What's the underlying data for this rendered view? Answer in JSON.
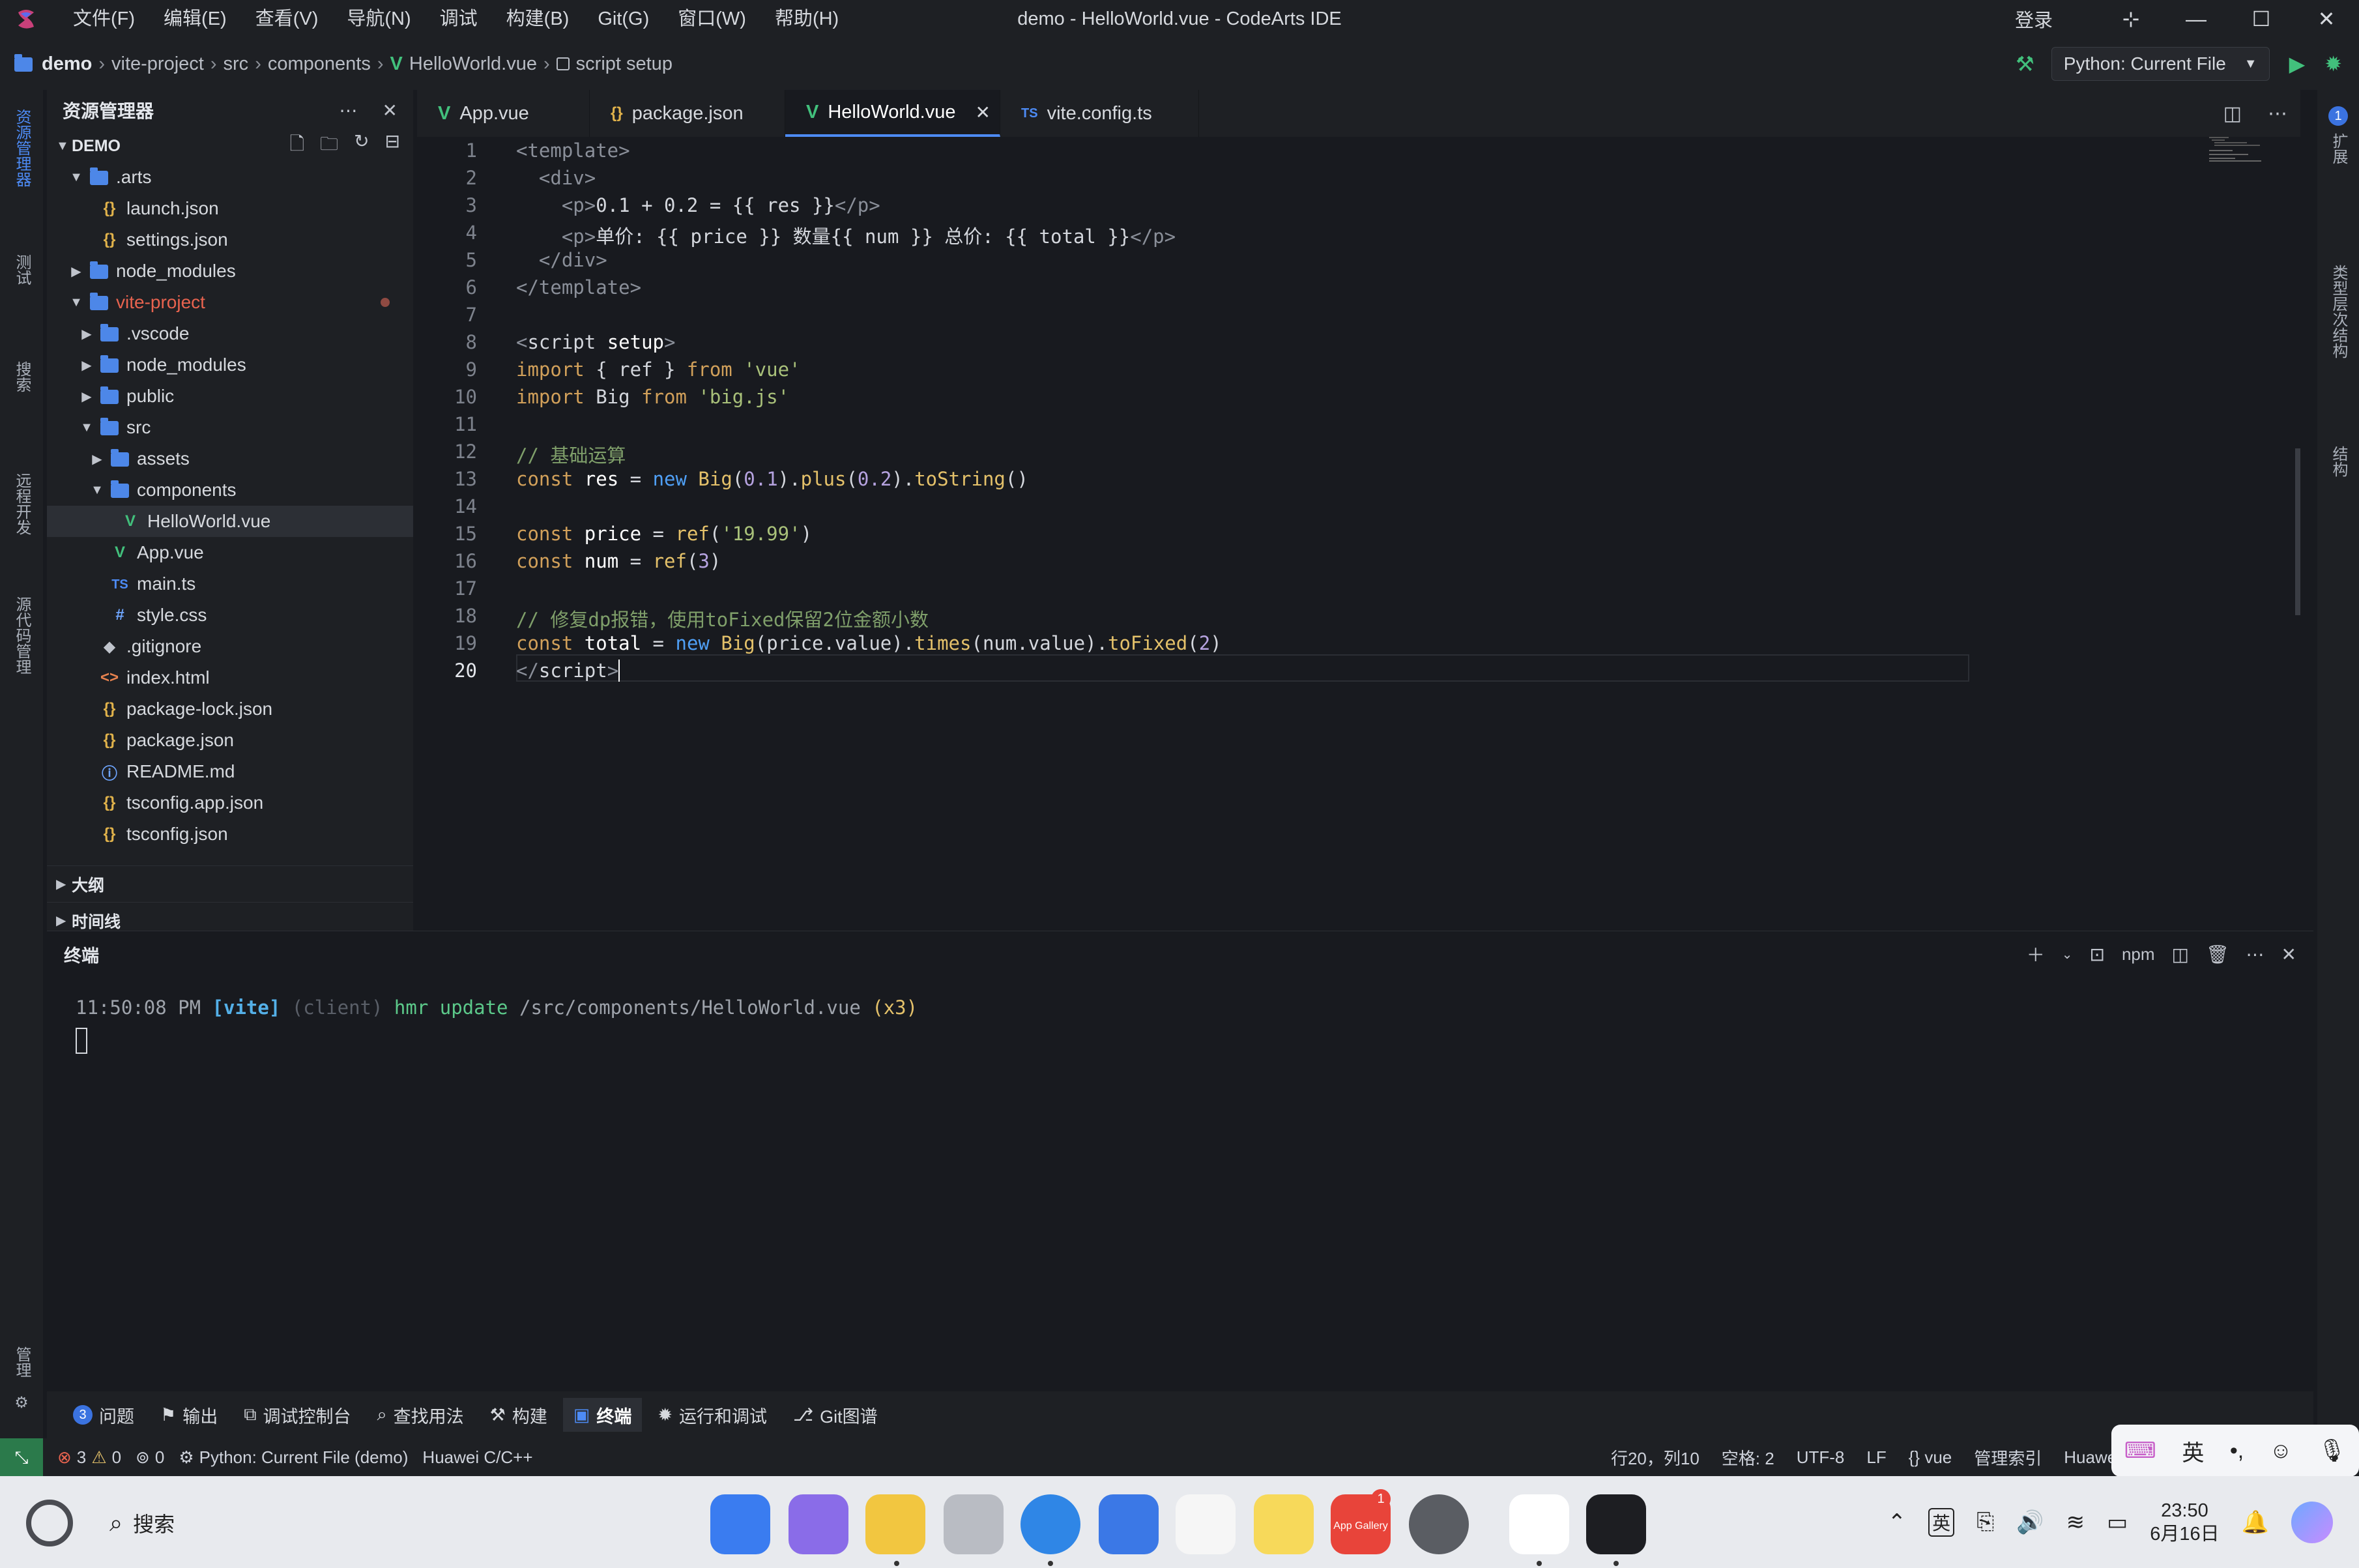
{
  "window": {
    "title": "demo - HelloWorld.vue - CodeArts IDE",
    "menu": [
      "文件(F)",
      "编辑(E)",
      "查看(V)",
      "导航(N)",
      "调试",
      "构建(B)",
      "Git(G)",
      "窗口(W)",
      "帮助(H)"
    ],
    "login": "登录"
  },
  "breadcrumb": [
    "demo",
    "vite-project",
    "src",
    "components",
    "HelloWorld.vue",
    "script setup"
  ],
  "run_config": "Python: Current File",
  "activity": [
    "资源管理器",
    "测试",
    "搜索",
    "远程开发",
    "源代码管理",
    "管理"
  ],
  "right_activity": [
    "扩展",
    "类型层次结构",
    "结构"
  ],
  "explorer": {
    "title": "资源管理器",
    "root": "DEMO",
    "items": [
      {
        "label": ".arts",
        "depth": 1,
        "kind": "folder-open"
      },
      {
        "label": "launch.json",
        "depth": 2,
        "kind": "json"
      },
      {
        "label": "settings.json",
        "depth": 2,
        "kind": "json"
      },
      {
        "label": "node_modules",
        "depth": 1,
        "kind": "folder"
      },
      {
        "label": "vite-project",
        "depth": 1,
        "kind": "folder-open"
      },
      {
        "label": ".vscode",
        "depth": 2,
        "kind": "folder"
      },
      {
        "label": "node_modules",
        "depth": 2,
        "kind": "folder"
      },
      {
        "label": "public",
        "depth": 2,
        "kind": "folder"
      },
      {
        "label": "src",
        "depth": 2,
        "kind": "folder-open"
      },
      {
        "label": "assets",
        "depth": 3,
        "kind": "folder"
      },
      {
        "label": "components",
        "depth": 3,
        "kind": "folder-open"
      },
      {
        "label": "HelloWorld.vue",
        "depth": 4,
        "kind": "vue"
      },
      {
        "label": "App.vue",
        "depth": 3,
        "kind": "vue"
      },
      {
        "label": "main.ts",
        "depth": 3,
        "kind": "ts"
      },
      {
        "label": "style.css",
        "depth": 3,
        "kind": "css"
      },
      {
        "label": ".gitignore",
        "depth": 2,
        "kind": "git"
      },
      {
        "label": "index.html",
        "depth": 2,
        "kind": "html"
      },
      {
        "label": "package-lock.json",
        "depth": 2,
        "kind": "json"
      },
      {
        "label": "package.json",
        "depth": 2,
        "kind": "json"
      },
      {
        "label": "README.md",
        "depth": 2,
        "kind": "info"
      },
      {
        "label": "tsconfig.app.json",
        "depth": 2,
        "kind": "json"
      },
      {
        "label": "tsconfig.json",
        "depth": 2,
        "kind": "json"
      }
    ],
    "outline": "大纲",
    "timeline": "时间线"
  },
  "tabs": [
    {
      "label": "App.vue",
      "kind": "vue"
    },
    {
      "label": "package.json",
      "kind": "json"
    },
    {
      "label": "HelloWorld.vue",
      "kind": "vue",
      "active": true
    },
    {
      "label": "vite.config.ts",
      "kind": "ts"
    }
  ],
  "editor": {
    "current_line": 20,
    "lines": [
      "1",
      "2",
      "3",
      "4",
      "5",
      "6",
      "7",
      "8",
      "9",
      "10",
      "11",
      "12",
      "13",
      "14",
      "15",
      "16",
      "17",
      "18",
      "19",
      "20"
    ]
  },
  "panel": {
    "title": "终端",
    "shell": "npm",
    "terminal": {
      "time": "11:50:08 PM",
      "tag": "[vite]",
      "client": "(client)",
      "msg": "hmr update",
      "path": "/src/components/HelloWorld.vue",
      "count": "(x3)"
    }
  },
  "bottom_tabs": [
    {
      "label": "问题",
      "badge": "3"
    },
    {
      "label": "输出"
    },
    {
      "label": "调试控制台"
    },
    {
      "label": "查找用法"
    },
    {
      "label": "构建"
    },
    {
      "label": "终端",
      "active": true
    },
    {
      "label": "运行和调试"
    },
    {
      "label": "Git图谱"
    }
  ],
  "status": {
    "errors": "3",
    "warnings": "0",
    "ports": "0",
    "run": "Python: Current File (demo)",
    "toolchain": "Huawei C/C++",
    "position": "行20，列10",
    "spaces": "空格: 2",
    "encoding": "UTF-8",
    "eol": "LF",
    "lang": "vue",
    "index": "管理索引",
    "huawei": "Huawei C"
  },
  "ime": [
    "英"
  ],
  "taskbar": {
    "search": "搜索",
    "time": "23:50",
    "date": "6月16日",
    "ime": "英",
    "appgallery_badge": "1",
    "appgallery_label": "App Gallery"
  }
}
